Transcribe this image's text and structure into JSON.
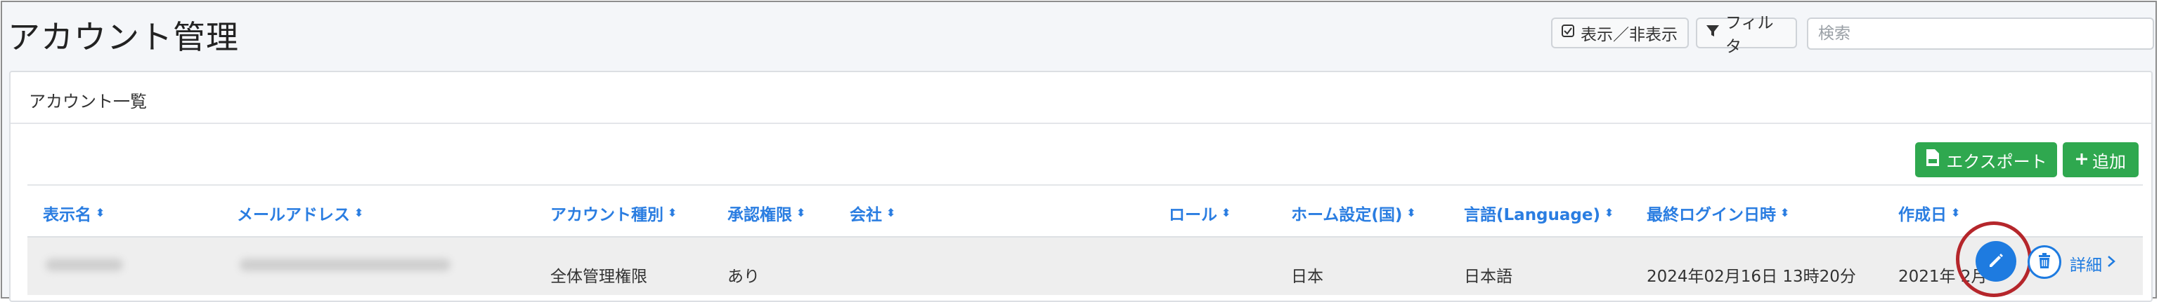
{
  "header": {
    "title": "アカウント管理",
    "toggle_label": "表示／非表示",
    "filter_label": "フィルタ",
    "search_placeholder": "検索"
  },
  "card": {
    "title": "アカウント一覧",
    "export_label": "エクスポート",
    "add_label": "追加"
  },
  "table": {
    "columns": {
      "display_name": "表示名",
      "email": "メールアドレス",
      "account_type": "アカウント種別",
      "approval": "承認権限",
      "company": "会社",
      "role": "ロール",
      "home_country": "ホーム設定(国)",
      "language": "言語(Language)",
      "last_login": "最終ログイン日時",
      "created": "作成日"
    },
    "rows": [
      {
        "account_type": "全体管理権限",
        "approval": "あり",
        "home_country": "日本",
        "language": "日本語",
        "last_login": "2024年02月16日 13時20分",
        "created": "2021年 2月",
        "detail_label": "詳細"
      }
    ]
  },
  "colors": {
    "accent": "#1e7be0",
    "success": "#2fa84f",
    "highlight": "#b5262b"
  },
  "icons": [
    "checkbox-icon",
    "filter-icon",
    "file-export-icon",
    "plus-icon",
    "sort-icon",
    "pencil-icon",
    "trash-icon",
    "chevron-right-icon"
  ]
}
